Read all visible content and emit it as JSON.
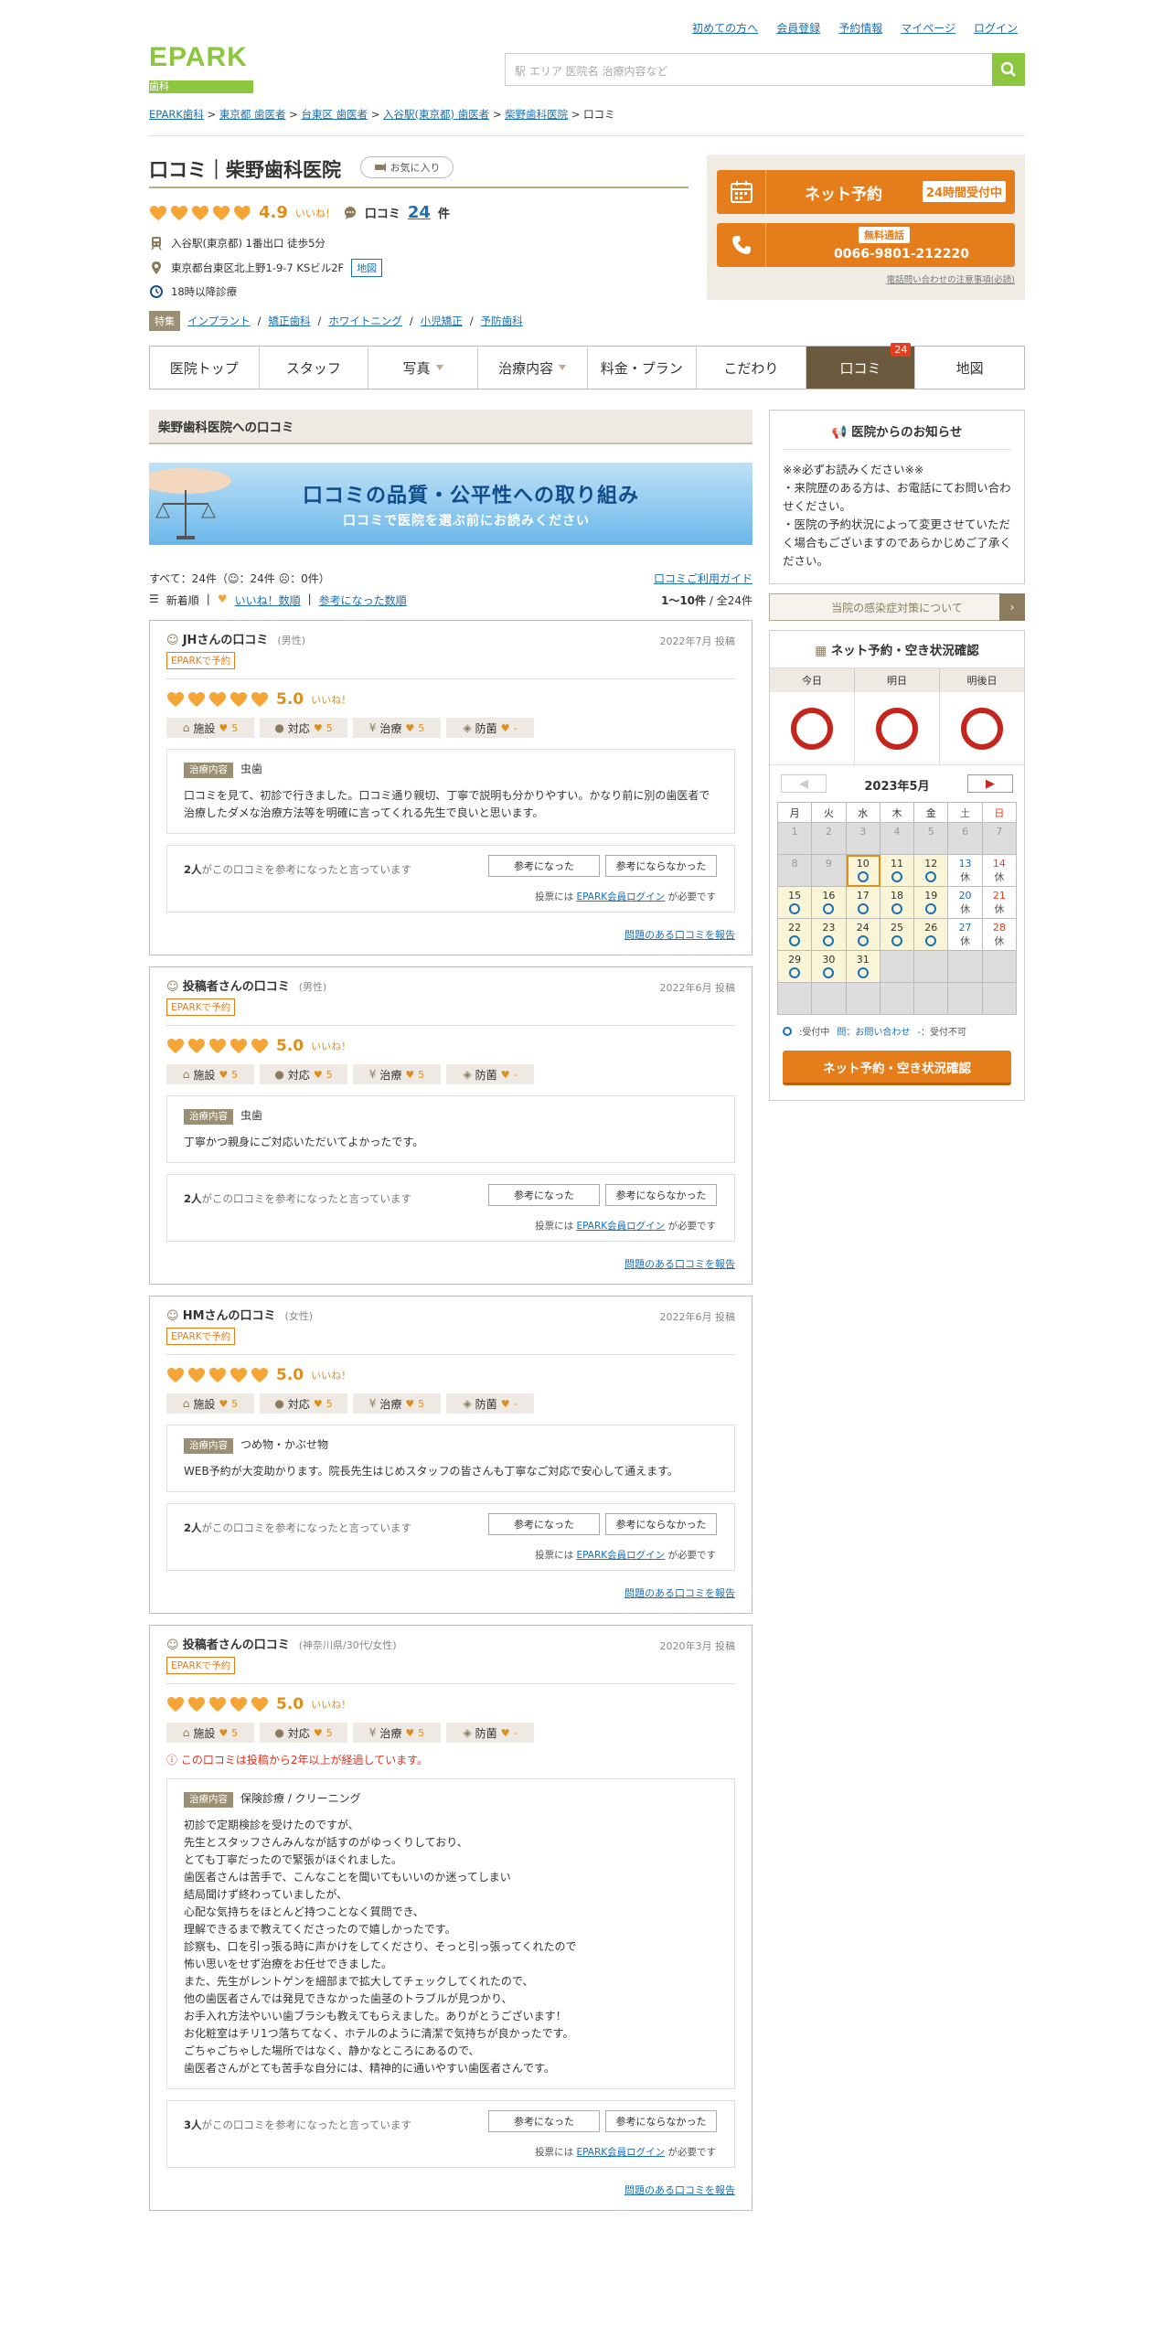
{
  "top_links": [
    "初めての方へ",
    "会員登録",
    "予約情報",
    "マイページ",
    "ログイン"
  ],
  "logo": {
    "main": "EPARK",
    "sub": "歯科"
  },
  "search": {
    "placeholder": "駅 エリア 医院名 治療内容など"
  },
  "breadcrumb": [
    "EPARK歯科",
    "東京都 歯医者",
    "台東区 歯医者",
    "入谷駅(東京都) 歯医者",
    "柴野歯科医院",
    "口コミ"
  ],
  "page": {
    "title": "口コミ｜柴野歯科医院",
    "fav": "お気に入り"
  },
  "rating": {
    "score": "4.9",
    "iine": "いいね！",
    "review_label": "口コミ",
    "review_count": "24",
    "review_unit": "件",
    "hearts": 4.9
  },
  "clinic_info": {
    "access": "入谷駅(東京都) 1番出口 徒歩5分",
    "address": "東京都台東区北上野1-9-7 KSビル2F",
    "map": "地図",
    "hours": "18時以降診療",
    "feature_label": "特集",
    "features": [
      "インプラント",
      "矯正歯科",
      "ホワイトニング",
      "小児矯正",
      "予防歯科"
    ]
  },
  "booking": {
    "net_label": "ネット予約",
    "net_badge": "24時間受付中",
    "free_call": "無料通話",
    "tel": "0066-9801-212220",
    "note": "電話問い合わせの注意事項(必読)"
  },
  "nav": [
    {
      "label": "医院トップ"
    },
    {
      "label": "スタッフ"
    },
    {
      "label": "写真",
      "caret": true
    },
    {
      "label": "治療内容",
      "caret": true
    },
    {
      "label": "料金・プラン"
    },
    {
      "label": "こだわり"
    },
    {
      "label": "口コミ",
      "active": true,
      "badge": "24"
    },
    {
      "label": "地図"
    }
  ],
  "section_title": "柴野歯科医院への口コミ",
  "banner": {
    "title": "口コミの品質・公平性への取り組み",
    "sub": "口コミで医院を選ぶ前にお読みください"
  },
  "summary": {
    "counts": "すべて：24件（",
    "c_good": "：24件",
    "c_bad": "：0件）",
    "sort": [
      "新着順",
      "いいね！数順",
      "参考になった数順"
    ],
    "guide": "口コミご利用ガイド",
    "pager_range": "1～10件",
    "pager_total": "全24件"
  },
  "reviews": [
    {
      "name": "JHさんの口コミ",
      "meta": "(男性)",
      "date": "2022年7月 投稿",
      "epk": "EPARKで予約",
      "score": "5.0",
      "sub": [
        [
          "施設",
          "5"
        ],
        [
          "対応",
          "5"
        ],
        [
          "治療",
          "5"
        ],
        [
          "防菌",
          "-"
        ]
      ],
      "warn": "",
      "kind": "虫歯",
      "body": "口コミを見て、初診で行きました。口コミ通り親切、丁寧で説明も分かりやすい。かなり前に別の歯医者で治療したダメな治療方法等を明確に言ってくれる先生で良いと思います。",
      "votes": "2人",
      "vote_text": "がこの口コミを参考になったと言っています"
    },
    {
      "name": "投稿者さんの口コミ",
      "meta": "(男性)",
      "date": "2022年6月 投稿",
      "epk": "EPARKで予約",
      "score": "5.0",
      "sub": [
        [
          "施設",
          "5"
        ],
        [
          "対応",
          "5"
        ],
        [
          "治療",
          "5"
        ],
        [
          "防菌",
          "-"
        ]
      ],
      "warn": "",
      "kind": "虫歯",
      "body": "丁寧かつ親身にご対応いただいてよかったです。",
      "votes": "2人",
      "vote_text": "がこの口コミを参考になったと言っています"
    },
    {
      "name": "HMさんの口コミ",
      "meta": "(女性)",
      "date": "2022年6月 投稿",
      "epk": "EPARKで予約",
      "score": "5.0",
      "sub": [
        [
          "施設",
          "5"
        ],
        [
          "対応",
          "5"
        ],
        [
          "治療",
          "5"
        ],
        [
          "防菌",
          "-"
        ]
      ],
      "warn": "",
      "kind": "つめ物・かぶせ物",
      "body": "WEB予約が大変助かります。院長先生はじめスタッフの皆さんも丁寧なご対応で安心して通えます。",
      "votes": "2人",
      "vote_text": "がこの口コミを参考になったと言っています"
    },
    {
      "name": "投稿者さんの口コミ",
      "meta": "(神奈川県/30代/女性)",
      "date": "2020年3月 投稿",
      "epk": "EPARKで予約",
      "score": "5.0",
      "sub": [
        [
          "施設",
          "5"
        ],
        [
          "対応",
          "5"
        ],
        [
          "治療",
          "5"
        ],
        [
          "防菌",
          "-"
        ]
      ],
      "warn": "この口コミは投稿から2年以上が経過しています。",
      "kind": "保険診療 / クリーニング",
      "body": "初診で定期検診を受けたのですが、\n先生とスタッフさんみんなが話すのがゆっくりしており、\nとても丁寧だったので緊張がほぐれました。\n歯医者さんは苦手で、こんなことを聞いてもいいのか迷ってしまい\n結局聞けず終わっていましたが、\n心配な気持ちをほとんど持つことなく質問でき、\n理解できるまで教えてくださったので嬉しかったです。\n診察も、口を引っ張る時に声かけをしてくださり、そっと引っ張ってくれたので\n怖い思いをせず治療をお任せできました。\nまた、先生がレントゲンを細部まで拡大してチェックしてくれたので、\n他の歯医者さんでは発見できなかった歯茎のトラブルが見つかり、\nお手入れ方法やいい歯ブラシも教えてもらえました。ありがとうございます！\nお化粧室はチリ1つ落ちてなく、ホテルのように清潔で気持ちが良かったです。\nごちゃごちゃした場所ではなく、静かなところにあるので、\n歯医者さんがとても苦手な自分には、精神的に通いやすい歯医者さんです。",
      "votes": "3人",
      "vote_text": "がこの口コミを参考になったと言っています"
    }
  ],
  "vote_buttons": {
    "yes": "参考になった",
    "no": "参考にならなかった",
    "note_pre": "投票には",
    "note_link": "EPARK会員ログイン",
    "note_post": "が必要です"
  },
  "report_link": "問題のある口コミを報告",
  "notice": {
    "title": "医院からのお知らせ",
    "body": "※※必ずお読みください※※\n・来院歴のある方は、お電話にてお問い合わせください。\n・医院の予約状況によって変更させていただく場合もございますのであらかじめご了承ください。"
  },
  "infection": "当院の感染症対策について",
  "calendar": {
    "title": "ネット予約・空き状況確認",
    "days3": [
      "今日",
      "明日",
      "明後日"
    ],
    "month": "2023年5月",
    "weekdays": [
      "月",
      "火",
      "水",
      "木",
      "金",
      "土",
      "日"
    ],
    "cells": [
      {
        "d": "1",
        "s": "gray"
      },
      {
        "d": "2",
        "s": "gray"
      },
      {
        "d": "3",
        "s": "gray"
      },
      {
        "d": "4",
        "s": "gray"
      },
      {
        "d": "5",
        "s": "gray"
      },
      {
        "d": "6",
        "s": "gray"
      },
      {
        "d": "7",
        "s": "gray"
      },
      {
        "d": "8",
        "s": "gray"
      },
      {
        "d": "9",
        "s": "gray"
      },
      {
        "d": "10",
        "s": "avail",
        "m": "o",
        "today": true
      },
      {
        "d": "11",
        "s": "avail",
        "m": "o"
      },
      {
        "d": "12",
        "s": "avail",
        "m": "o"
      },
      {
        "d": "13",
        "s": "sat",
        "t": "休"
      },
      {
        "d": "14",
        "s": "sun",
        "t": "休"
      },
      {
        "d": "15",
        "s": "avail",
        "m": "o"
      },
      {
        "d": "16",
        "s": "avail",
        "m": "o"
      },
      {
        "d": "17",
        "s": "avail",
        "m": "o"
      },
      {
        "d": "18",
        "s": "avail",
        "m": "o"
      },
      {
        "d": "19",
        "s": "avail",
        "m": "o"
      },
      {
        "d": "20",
        "s": "sat",
        "t": "休"
      },
      {
        "d": "21",
        "s": "sun",
        "t": "休"
      },
      {
        "d": "22",
        "s": "avail",
        "m": "o"
      },
      {
        "d": "23",
        "s": "avail",
        "m": "o"
      },
      {
        "d": "24",
        "s": "avail",
        "m": "o"
      },
      {
        "d": "25",
        "s": "avail",
        "m": "o"
      },
      {
        "d": "26",
        "s": "avail",
        "m": "o"
      },
      {
        "d": "27",
        "s": "sat",
        "t": "休"
      },
      {
        "d": "28",
        "s": "sun",
        "t": "休"
      },
      {
        "d": "29",
        "s": "avail",
        "m": "o"
      },
      {
        "d": "30",
        "s": "avail",
        "m": "o"
      },
      {
        "d": "31",
        "s": "avail",
        "m": "o"
      },
      {
        "d": "",
        "s": "gray"
      },
      {
        "d": "",
        "s": "gray"
      },
      {
        "d": "",
        "s": "gray"
      },
      {
        "d": "",
        "s": "gray"
      },
      {
        "d": "",
        "s": "gray"
      },
      {
        "d": "",
        "s": "gray"
      },
      {
        "d": "",
        "s": "gray"
      },
      {
        "d": "",
        "s": "gray"
      },
      {
        "d": "",
        "s": "gray"
      },
      {
        "d": "",
        "s": "gray"
      },
      {
        "d": "",
        "s": "gray"
      }
    ],
    "legend": [
      ":受付中",
      "問：お問い合わせ",
      "-：受付不可"
    ],
    "button": "ネット予約・空き状況確認"
  },
  "colors": {
    "accent": "#e57d1b",
    "brand": "#8cc63f",
    "link": "#1a6fb5",
    "nav_active": "#6b5a3d"
  }
}
